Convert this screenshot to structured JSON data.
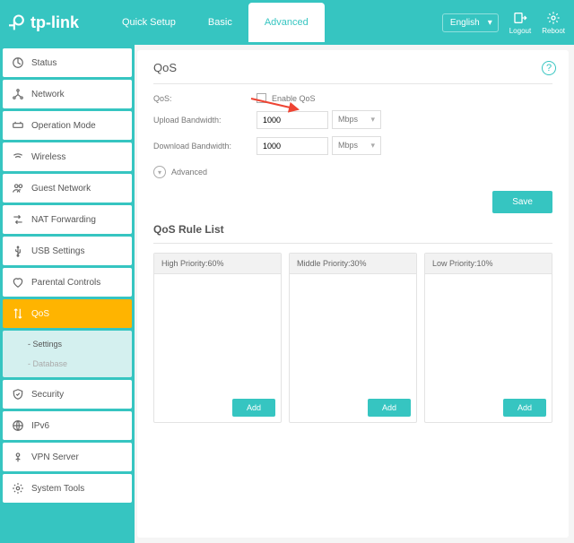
{
  "brand": "tp-link",
  "header": {
    "tabs": [
      "Quick Setup",
      "Basic",
      "Advanced"
    ],
    "active_tab": 2,
    "language": "English",
    "logout": "Logout",
    "reboot": "Reboot"
  },
  "sidebar": {
    "items": [
      {
        "label": "Status",
        "icon": "status-icon"
      },
      {
        "label": "Network",
        "icon": "network-icon"
      },
      {
        "label": "Operation Mode",
        "icon": "opmode-icon"
      },
      {
        "label": "Wireless",
        "icon": "wireless-icon"
      },
      {
        "label": "Guest Network",
        "icon": "guest-icon"
      },
      {
        "label": "NAT Forwarding",
        "icon": "nat-icon"
      },
      {
        "label": "USB Settings",
        "icon": "usb-icon"
      },
      {
        "label": "Parental Controls",
        "icon": "parental-icon"
      },
      {
        "label": "QoS",
        "icon": "qos-icon",
        "active": true
      },
      {
        "label": "Security",
        "icon": "security-icon"
      },
      {
        "label": "IPv6",
        "icon": "ipv6-icon"
      },
      {
        "label": "VPN Server",
        "icon": "vpn-icon"
      },
      {
        "label": "System Tools",
        "icon": "system-icon"
      }
    ],
    "sub": [
      "- Settings",
      "- Database"
    ]
  },
  "qos": {
    "title": "QoS",
    "label_qos": "QoS:",
    "enable_label": "Enable QoS",
    "upload_label": "Upload Bandwidth:",
    "download_label": "Download Bandwidth:",
    "upload_value": "1000",
    "download_value": "1000",
    "unit": "Mbps",
    "advanced": "Advanced",
    "save": "Save",
    "rule_list_title": "QoS Rule List",
    "cols": [
      {
        "head": "High Priority:60%"
      },
      {
        "head": "Middle Priority:30%"
      },
      {
        "head": "Low Priority:10%"
      }
    ],
    "add": "Add"
  }
}
